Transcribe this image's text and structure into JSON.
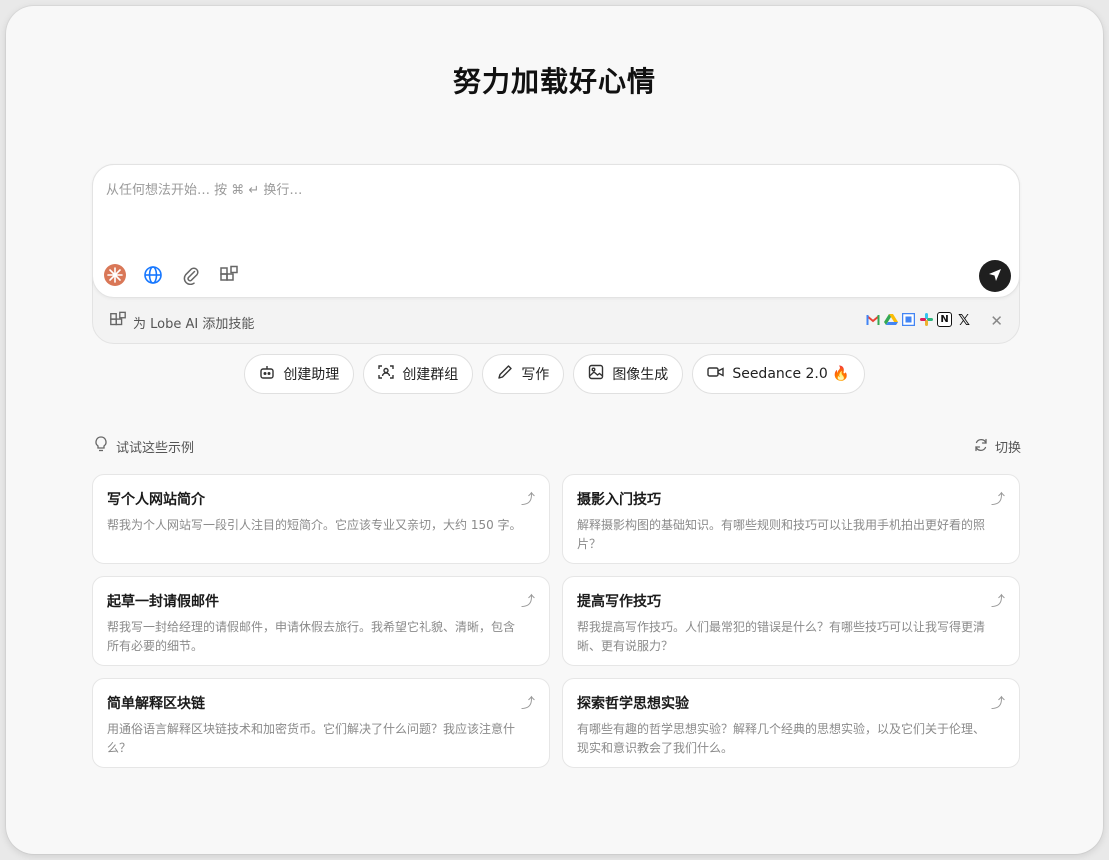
{
  "title": "努力加载好心情",
  "composer": {
    "placeholder": "从任何想法开始… 按 ⌘ ↵ 换行…",
    "tools": [
      "model-icon",
      "globe-icon",
      "paperclip-icon",
      "skills-icon"
    ],
    "send_icon": "send-icon"
  },
  "skill_bar": {
    "label": "为 Lobe AI 添加技能",
    "integrations": [
      "gmail-icon",
      "google-drive-icon",
      "google-calendar-icon",
      "slack-icon",
      "notion-icon",
      "x-icon"
    ]
  },
  "quick_actions": [
    {
      "label": "创建助理",
      "icon": "robot-icon"
    },
    {
      "label": "创建群组",
      "icon": "group-scan-icon"
    },
    {
      "label": "写作",
      "icon": "pen-icon"
    },
    {
      "label": "图像生成",
      "icon": "image-icon"
    },
    {
      "label": "Seedance 2.0 🔥",
      "icon": "video-icon"
    }
  ],
  "examples": {
    "heading": "试试这些示例",
    "switch_label": "切换",
    "cards": [
      {
        "title": "写个人网站简介",
        "desc": "帮我为个人网站写一段引人注目的短简介。它应该专业又亲切，大约 150 字。"
      },
      {
        "title": "摄影入门技巧",
        "desc": "解释摄影构图的基础知识。有哪些规则和技巧可以让我用手机拍出更好看的照片？"
      },
      {
        "title": "起草一封请假邮件",
        "desc": "帮我写一封给经理的请假邮件，申请休假去旅行。我希望它礼貌、清晰，包含所有必要的细节。"
      },
      {
        "title": "提高写作技巧",
        "desc": "帮我提高写作技巧。人们最常犯的错误是什么？有哪些技巧可以让我写得更清晰、更有说服力？"
      },
      {
        "title": "简单解释区块链",
        "desc": "用通俗语言解释区块链技术和加密货币。它们解决了什么问题？我应该注意什么？"
      },
      {
        "title": "探索哲学思想实验",
        "desc": "有哪些有趣的哲学思想实验？解释几个经典的思想实验，以及它们关于伦理、现实和意识教会了我们什么。"
      }
    ]
  },
  "colors": {
    "send_button": "#1f1f1f",
    "card_border": "#e6e6e6",
    "model_icon": "#d97757",
    "globe_icon": "#1677ff"
  }
}
